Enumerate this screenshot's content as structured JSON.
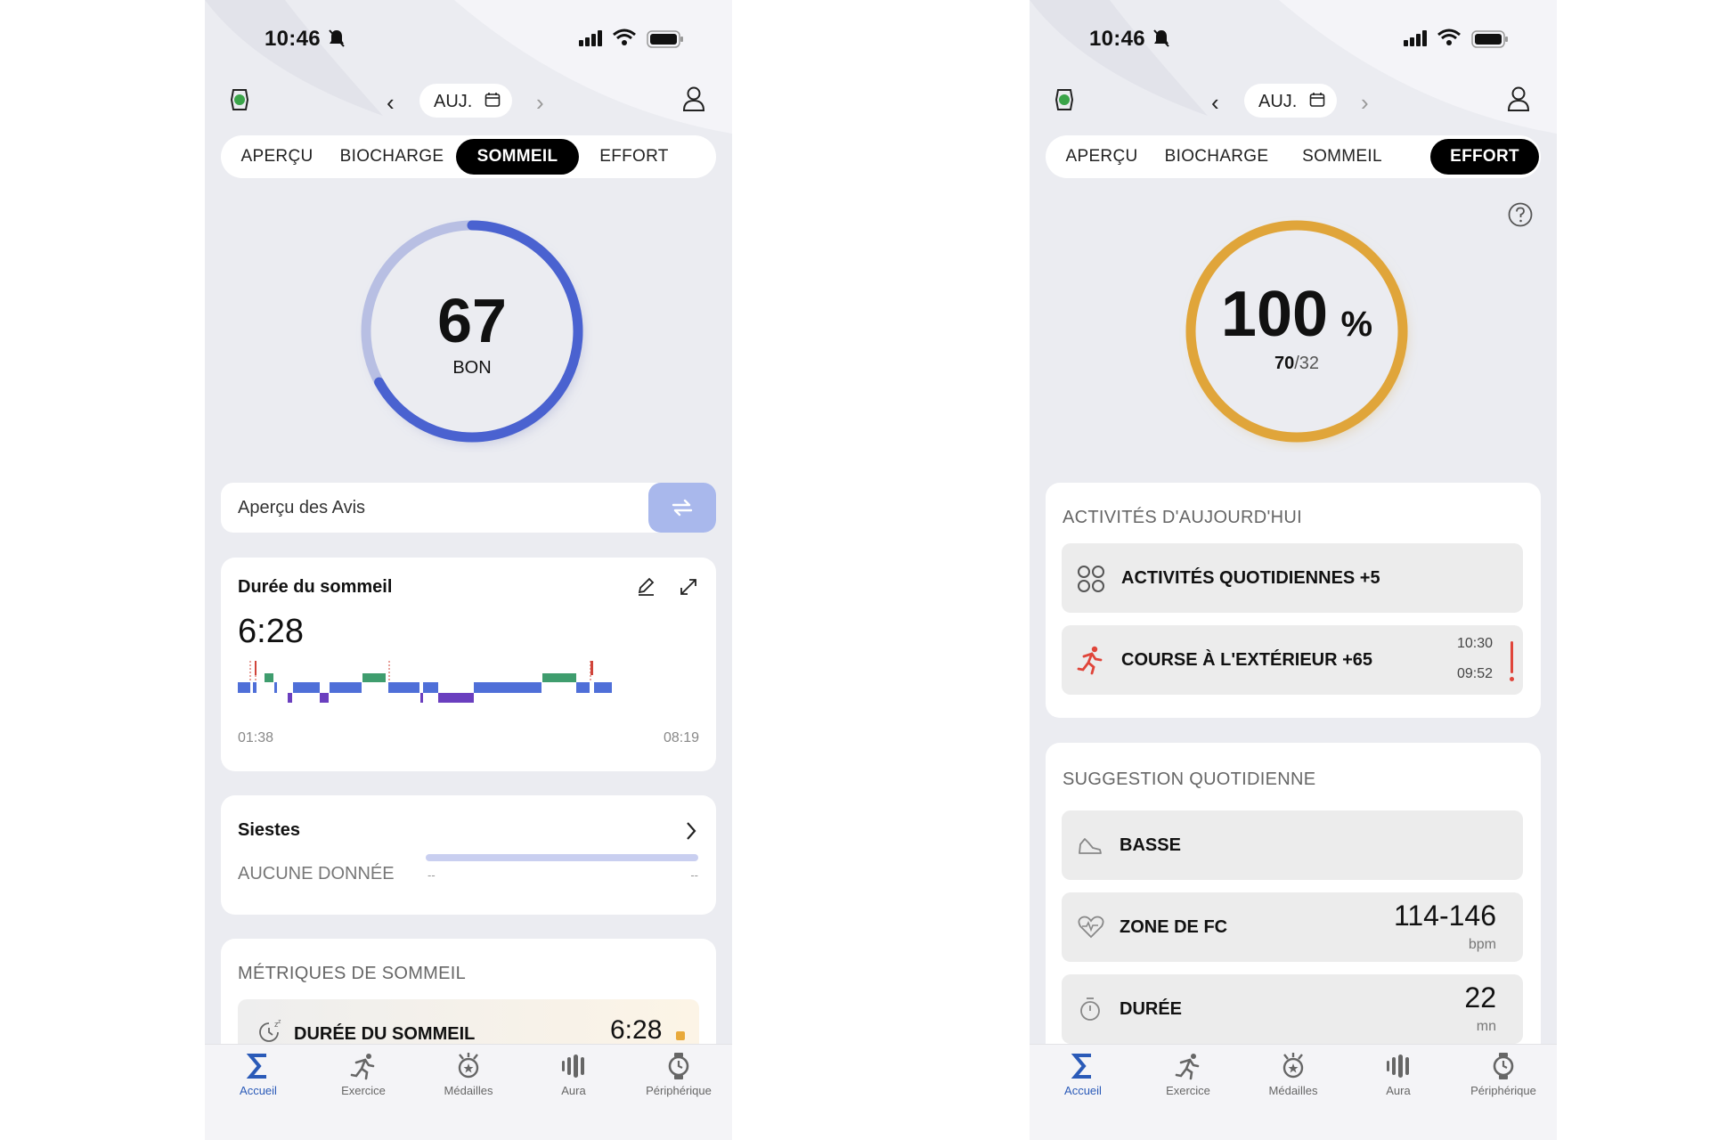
{
  "left_phone": {
    "status": {
      "time": "10:46"
    },
    "header": {
      "date_label": "AUJ."
    },
    "tabs": [
      {
        "label": "APERÇU",
        "active": false
      },
      {
        "label": "BIOCHARGE",
        "active": false
      },
      {
        "label": "SOMMEIL",
        "active": true
      },
      {
        "label": "EFFORT",
        "active": false
      }
    ],
    "score": {
      "value": "67",
      "label": "BON",
      "fraction": 0.67,
      "color": "#4a62d0"
    },
    "insights": {
      "label": "Aperçu des Avis"
    },
    "sleep_duration": {
      "title": "Durée du sommeil",
      "value": "6:28",
      "start": "01:38",
      "end": "08:19"
    },
    "naps": {
      "title": "Siestes",
      "empty": "AUCUNE DONNÉE",
      "dash1": "--",
      "dash2": "--"
    },
    "metrics": {
      "title": "MÉTRIQUES DE SOMMEIL",
      "row_label": "DURÉE DU SOMMEIL",
      "row_value": "6:28"
    },
    "colors": {
      "deep": "#6a3fbf",
      "light": "#4f6fd8",
      "rem": "#3f9d6e",
      "awake": "#d0443a"
    }
  },
  "right_phone": {
    "status": {
      "time": "10:46"
    },
    "header": {
      "date_label": "AUJ."
    },
    "tabs": [
      {
        "label": "APERÇU",
        "active": false
      },
      {
        "label": "BIOCHARGE",
        "active": false
      },
      {
        "label": "SOMMEIL",
        "active": false
      },
      {
        "label": "EFFORT",
        "active": true
      }
    ],
    "score": {
      "value": "100",
      "unit": "%",
      "sub_main": "70",
      "sub_rest": "/32",
      "fraction": 1.0,
      "color": "#e0a53a"
    },
    "activities": {
      "title": "ACTIVITÉS D'AUJOURD'HUI",
      "items": [
        {
          "label": "ACTIVITÉS QUOTIDIENNES +5"
        },
        {
          "label": "COURSE À L'EXTÉRIEUR +65",
          "time_start": "10:30",
          "time_end": "09:52"
        }
      ]
    },
    "suggestion": {
      "title": "SUGGESTION QUOTIDIENNE",
      "items": [
        {
          "label": "BASSE"
        },
        {
          "label": "ZONE DE FC",
          "value": "114-146",
          "unit": "bpm"
        },
        {
          "label": "DURÉE",
          "value": "22",
          "unit": "mn"
        }
      ]
    }
  },
  "bottom_nav": [
    {
      "label": "Accueil",
      "icon": "sigma-icon",
      "active": true
    },
    {
      "label": "Exercice",
      "icon": "runner-icon",
      "active": false
    },
    {
      "label": "Médailles",
      "icon": "medal-icon",
      "active": false
    },
    {
      "label": "Aura",
      "icon": "aura-icon",
      "active": false
    },
    {
      "label": "Périphérique",
      "icon": "watch-icon",
      "active": false
    }
  ]
}
